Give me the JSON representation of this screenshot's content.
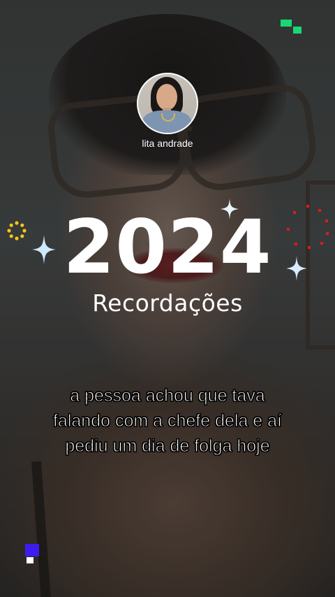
{
  "profile": {
    "username": "lita andrade",
    "avatar": "profile-photo"
  },
  "title": {
    "year": "2024",
    "subtitle": "Recordações"
  },
  "caption": {
    "line1": "a pessoa achou que tava",
    "line2": "falando com a chefe dela e aí",
    "line3": "pediu um dia de folga hoje"
  },
  "decorations": {
    "sparkle_icon": "four-point-star-icon",
    "yellow_ring_color": "#f5c518",
    "red_ring_color": "#e01b1b",
    "accent_green": "#18d873",
    "accent_blue": "#3d1cf0"
  }
}
